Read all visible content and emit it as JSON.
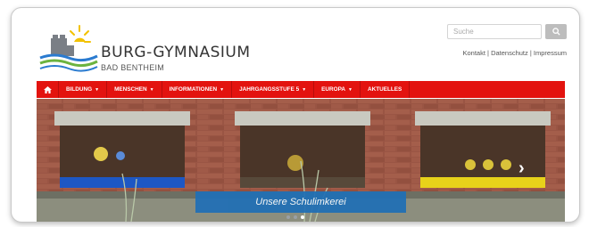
{
  "site": {
    "name": "BURG-GYMNASIUM",
    "town": "BAD BENTHEIM"
  },
  "search": {
    "placeholder": "Suche",
    "button_icon": "search-icon"
  },
  "toplinks": [
    "Kontakt",
    "Datenschutz",
    "Impressum"
  ],
  "nav": {
    "home_icon": "home-icon",
    "items": [
      {
        "label": "BILDUNG"
      },
      {
        "label": "MENSCHEN"
      },
      {
        "label": "INFORMATIONEN"
      },
      {
        "label": "JAHRGANGSSTUFE 5"
      },
      {
        "label": "EUROPA"
      },
      {
        "label": "AKTUELLES"
      }
    ]
  },
  "slider": {
    "caption": "Unsere Schulimkerei",
    "next_icon": "chevron-right-icon",
    "dots_count": 3,
    "active_dot": 2
  },
  "colors": {
    "nav_red": "#e3130f",
    "caption_blue": "#1f6fb6",
    "brick": "#8a4a3a"
  }
}
